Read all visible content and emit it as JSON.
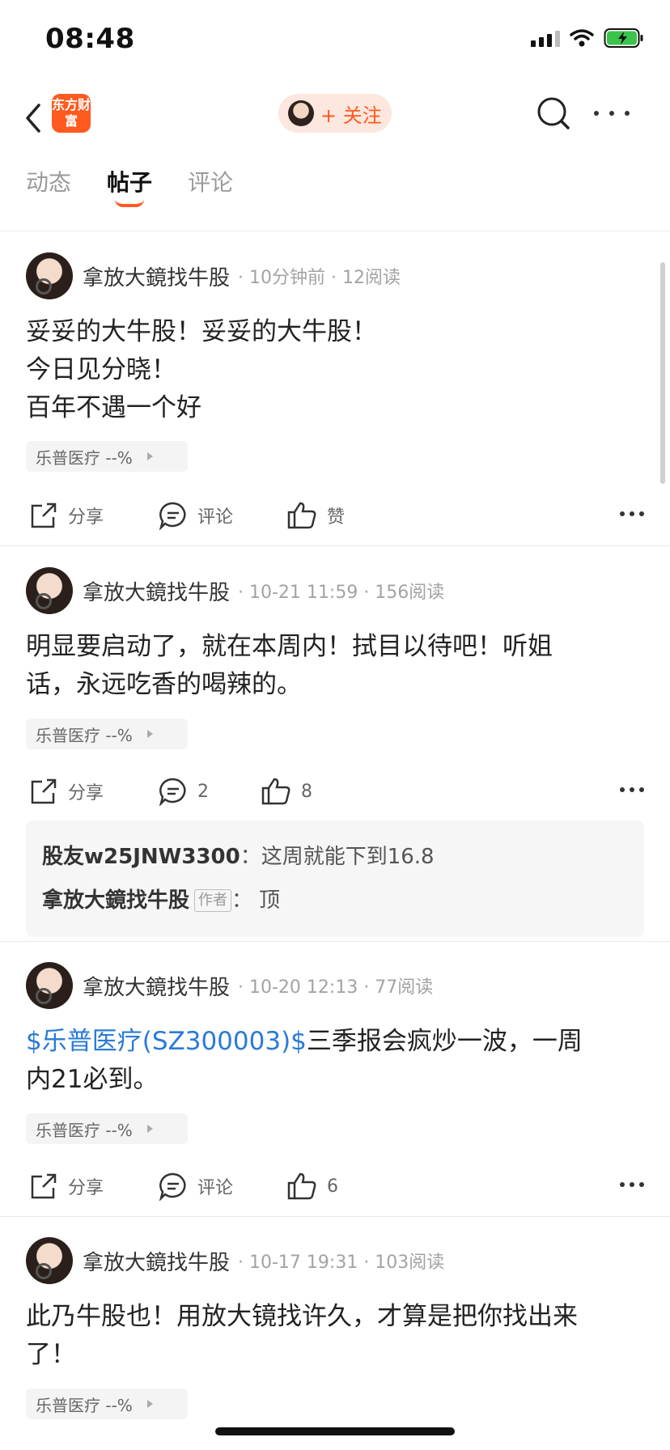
{
  "status": {
    "time": "08:48"
  },
  "nav": {
    "logo": "东方财富",
    "follow_label": "+ 关注"
  },
  "tabs": [
    {
      "label": "动态"
    },
    {
      "label": "帖子"
    },
    {
      "label": "评论"
    }
  ],
  "posts": [
    {
      "author": "拿放大鏡找牛股",
      "meta": "· 10分钟前 · 12阅读",
      "lines": [
        "妥妥的大牛股！妥妥的大牛股！",
        "今日见分晓！",
        "百年不遇一个好"
      ],
      "stock": "乐普医疗 --%",
      "share": "分享",
      "comment": "评论",
      "like": "赞"
    },
    {
      "author": "拿放大鏡找牛股",
      "meta": "· 10-21 11:59 · 156阅读",
      "lines": [
        "明显要启动了，就在本周内！拭目以待吧！听姐",
        "话，永远吃香的喝辣的。"
      ],
      "stock": "乐普医疗 --%",
      "share": "分享",
      "comment": "2",
      "like": "8",
      "comments": [
        {
          "name": "股友w25JNW3300",
          "sep": "：",
          "text": "这周就能下到16.8"
        },
        {
          "name": "拿放大鏡找牛股",
          "badge": "作者",
          "sep": "：",
          "text": "顶"
        }
      ]
    },
    {
      "author": "拿放大鏡找牛股",
      "meta": "· 10-20 12:13 · 77阅读",
      "link": "$乐普医疗(SZ300003)$",
      "line1_rest": "三季报会疯炒一波，一周",
      "line2": "内21必到。",
      "stock": "乐普医疗 --%",
      "share": "分享",
      "comment": "评论",
      "like": "6"
    },
    {
      "author": "拿放大鏡找牛股",
      "meta": "· 10-17 19:31 · 103阅读",
      "lines": [
        "此乃牛股也！用放大镜找许久，才算是把你找出来",
        "了！"
      ],
      "stock": "乐普医疗 --%"
    }
  ],
  "colors": {
    "accent": "#ff5a1f",
    "link": "#2a7bd6"
  }
}
